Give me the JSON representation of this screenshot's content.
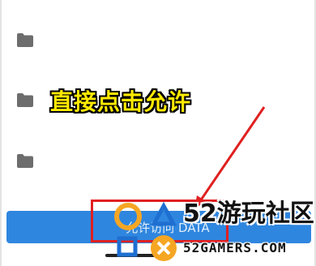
{
  "folders": [
    {
      "icon": "folder-icon",
      "name": ""
    },
    {
      "icon": "folder-icon",
      "name": ""
    },
    {
      "icon": "folder-icon",
      "name": ""
    }
  ],
  "annotation": {
    "text": "直接点击允许"
  },
  "allow_button": {
    "label": "允许访问 DATA"
  },
  "watermark": {
    "title": "52游玩社区",
    "domain": "52GAMERS.COM"
  },
  "colors": {
    "button": "#2f86df",
    "annotation_text": "#ffea00",
    "highlight": "#e02020",
    "folder_icon": "#6d6d6d",
    "logo_orange": "#f5a623",
    "logo_blue": "#1f6fd1"
  }
}
